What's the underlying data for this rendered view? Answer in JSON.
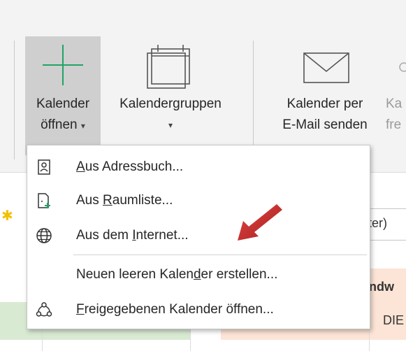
{
  "ribbon": {
    "open_calendar": {
      "line1": "Kalender",
      "line2": "öffnen",
      "caret": "▾",
      "icon": "plus-icon"
    },
    "calendar_groups": {
      "line1": "Kalendergruppen",
      "caret": "▾",
      "icon": "calendar-icon"
    },
    "email_calendar": {
      "line1": "Kalender per",
      "line2": "E-Mail senden",
      "icon": "envelope-icon"
    },
    "more": {
      "line1": "Ka",
      "line2": "fre"
    }
  },
  "background": {
    "box_text": "uter)",
    "week_text": "ndw",
    "day_text": "DIE"
  },
  "menu": {
    "items": [
      {
        "pre": "",
        "accel": "A",
        "post": "us Adressbuch...",
        "icon": "address-book-icon"
      },
      {
        "pre": "Aus ",
        "accel": "R",
        "post": "aumliste...",
        "icon": "room-list-icon"
      },
      {
        "pre": "Aus dem ",
        "accel": "I",
        "post": "nternet...",
        "icon": "globe-icon"
      },
      {
        "pre": "Neuen leeren Kalen",
        "accel": "d",
        "post": "er erstellen...",
        "icon": ""
      },
      {
        "pre": "",
        "accel": "F",
        "post": "reigegebenen Kalender öffnen...",
        "icon": "shared-calendar-icon"
      }
    ]
  },
  "colors": {
    "accent_green": "#21a366",
    "arrow_red": "#c0282d",
    "pressed_bg": "#cfcfcf"
  }
}
